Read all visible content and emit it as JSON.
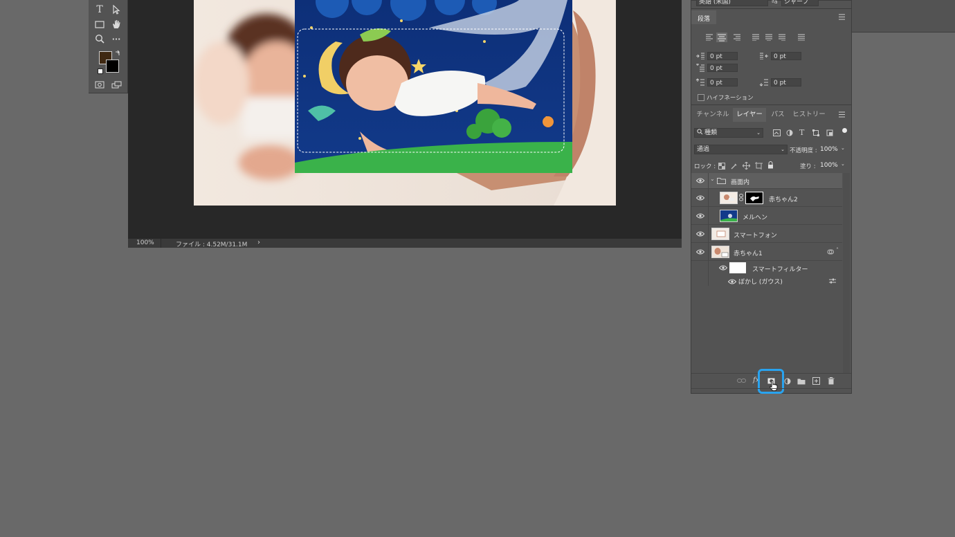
{
  "colors": {
    "accent": "#29a3ef",
    "bg": "#696969",
    "panel": "#535353",
    "selected_row": "#5f5f5f"
  },
  "toolbar": {
    "tools": [
      "type-tool",
      "path-select-tool",
      "rectangle-tool",
      "hand-tool",
      "zoom-tool",
      "more-tools",
      "screen-mode",
      "quick-mask"
    ],
    "type_glyph": "T",
    "more_glyph": "···"
  },
  "document": {
    "zoom": "100%",
    "file_info": "ファイル : 4.52M/31.1M",
    "arrow": "›"
  },
  "character": {
    "language": "英語 (米国)",
    "aa_label": "ªa",
    "aa_value": "シャープ"
  },
  "paragraph": {
    "title": "段落",
    "fields": {
      "indent_left": "0 pt",
      "indent_right": "0 pt",
      "indent_first": "0 pt",
      "space_before": "0 pt",
      "space_after": "0 pt"
    },
    "hyphenation": "ハイフネーション"
  },
  "layers_panel": {
    "tabs": [
      "チャンネル",
      "レイヤー",
      "パス",
      "ヒストリー"
    ],
    "active_tab": "レイヤー",
    "filter_kind": "種類",
    "blend_mode": "通過",
    "opacity_label": "不透明度 :",
    "opacity_value": "100%",
    "lock_label": "ロック :",
    "fill_label": "塗り :",
    "fill_value": "100%",
    "layers": [
      {
        "name": "画面内",
        "type": "group"
      },
      {
        "name": "赤ちゃん2",
        "type": "masked"
      },
      {
        "name": "メルヘン",
        "type": "normal"
      },
      {
        "name": "スマートフォン",
        "type": "normal"
      },
      {
        "name": "赤ちゃん1",
        "type": "smart"
      },
      {
        "name": "スマートフィルター",
        "type": "filter"
      },
      {
        "name": "ぼかし (ガウス)",
        "type": "filter-item"
      }
    ],
    "bottom_buttons": [
      "link-icon",
      "fx-icon",
      "add-mask-icon",
      "adjustment-icon",
      "folder-icon",
      "new-layer-icon",
      "trash-icon"
    ],
    "fx_label": "fx"
  }
}
